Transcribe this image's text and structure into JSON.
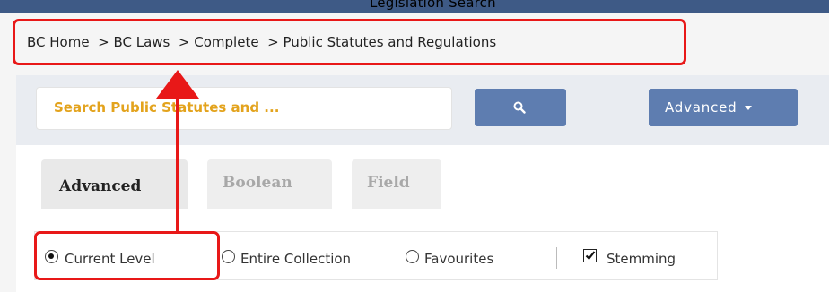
{
  "header": {
    "caption": "Legislation Search"
  },
  "breadcrumb": {
    "items": [
      "BC Home",
      "> BC Laws",
      "> Complete",
      "> Public Statutes and Regulations"
    ]
  },
  "search": {
    "placeholder": "Search Public Statutes and ...",
    "button_icon": "search-icon",
    "advanced_label": "Advanced"
  },
  "tabs": [
    {
      "label": "Advanced",
      "active": true
    },
    {
      "label": "Boolean",
      "active": false
    },
    {
      "label": "Field",
      "active": false
    }
  ],
  "scope": {
    "options": [
      {
        "label": "Current Level",
        "selected": true
      },
      {
        "label": "Entire Collection",
        "selected": false
      },
      {
        "label": "Favourites",
        "selected": false
      }
    ],
    "stemming": {
      "label": "Stemming",
      "checked": true
    }
  },
  "colors": {
    "top_bar": "#3e5a86",
    "button": "#5e7db0",
    "placeholder": "#e3a31d",
    "annotation": "#e81818"
  }
}
